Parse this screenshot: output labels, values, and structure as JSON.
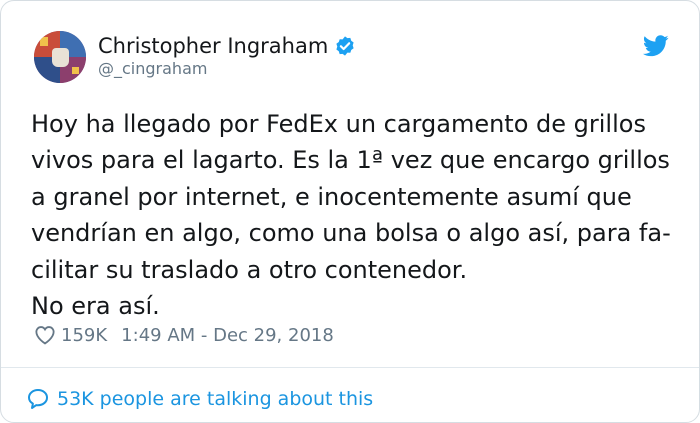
{
  "author": {
    "name": "Christopher Ingraham",
    "handle": "@_cingraham",
    "avatar_icon": "avatar-image",
    "verified_icon": "verified-badge-icon"
  },
  "tweet": {
    "lines": [
      "Hoy ha llegado por FedEx un cargamento de grillos",
      "vivos para el lagarto. Es la 1ª vez que encargo grillos",
      "a granel por internet, e inocentemente asumí que",
      "vendrían en algo, como una bolsa o algo así, para fa-",
      "cilitar su traslado a otro contenedor.",
      "No era así."
    ]
  },
  "meta": {
    "likes": "159K",
    "timestamp": "1:49 AM - Dec 29, 2018"
  },
  "footer": {
    "talking": "53K people are talking about this"
  },
  "colors": {
    "twitter_blue": "#1da1f2",
    "link_blue": "#1b95e0",
    "muted": "#657786",
    "text": "#14171a"
  }
}
